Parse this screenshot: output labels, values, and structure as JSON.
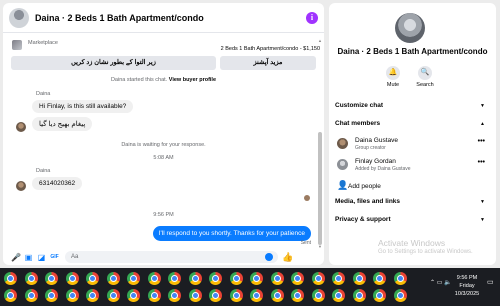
{
  "chat": {
    "title": "Daina · 2 Beds 1 Bath Apartment/condo",
    "info_icon": "info-icon",
    "marketplace_label": "Marketplace",
    "listing": "2 Beds 1 Bath Apartment/condo - $1,150",
    "quick_replies": [
      "زیر التوا کے بطور نشان زد کریں",
      "مزید آپشنز"
    ],
    "messages": {
      "started": "Daina started this chat.",
      "view_profile": "View buyer profile",
      "sender1": "Daina",
      "msg1": "Hi Finlay, is this still available?",
      "msg2": "پیغام بھیج دیا گیا",
      "waiting": "Daina is waiting for your response.",
      "time1": "5:08 AM",
      "sender2": "Daina",
      "msg3": "6314020362",
      "time2": "9:56 PM",
      "msg_out": "I'll respond to you shortly. Thanks for your patience",
      "sent": "Sent"
    },
    "composer_placeholder": "Aa"
  },
  "details": {
    "title": "Daina · 2 Beds 1 Bath Apartment/condo",
    "actions": [
      {
        "label": "Mute",
        "icon": "bell-icon"
      },
      {
        "label": "Search",
        "icon": "search-icon"
      }
    ],
    "customize_chat": "Customize chat",
    "chat_members": "Chat members",
    "members": [
      {
        "name": "Daina Gustave",
        "role": "Group creator"
      },
      {
        "name": "Finlay Gordan",
        "role": "Added by Daina Gustave"
      }
    ],
    "add_people": "Add people",
    "media": "Media, files and links",
    "privacy": "Privacy & support"
  },
  "watermark": {
    "line1": "Activate Windows",
    "line2": "Go to Settings to activate Windows."
  },
  "taskbar": {
    "app_icon": "chrome-icon",
    "time": "9:56 PM",
    "day": "Friday",
    "date": "10/3/2025"
  }
}
